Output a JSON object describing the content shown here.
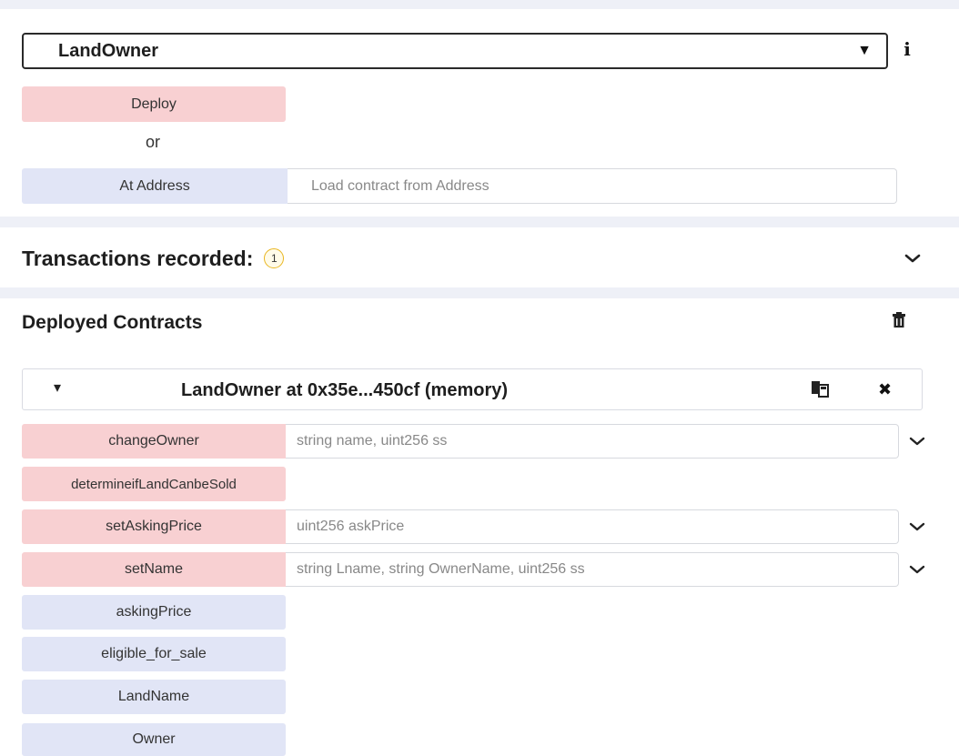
{
  "contract_select": {
    "selected": "LandOwner",
    "caret": "▼",
    "info_icon": "i"
  },
  "deploy": {
    "deploy_label": "Deploy",
    "or_label": "or",
    "at_address_label": "At Address",
    "address_placeholder": "Load contract from Address"
  },
  "transactions": {
    "label": "Transactions recorded:",
    "count": "1",
    "chevron": "⌄"
  },
  "deployed": {
    "title": "Deployed Contracts",
    "trash_icon": "trash-icon",
    "instance": {
      "toggle": "▾",
      "title": "LandOwner at 0x35e...450cf (memory)",
      "copy_icon": "copy-icon",
      "close": "✖"
    },
    "functions": [
      {
        "label": "changeOwner",
        "kind": "transact",
        "placeholder": "string name, uint256 ss",
        "chevron": "⌄"
      },
      {
        "label": "determineifLandCanbeSold",
        "kind": "transact",
        "placeholder": "",
        "chevron": ""
      },
      {
        "label": "setAskingPrice",
        "kind": "transact",
        "placeholder": "uint256 askPrice",
        "chevron": "⌄"
      },
      {
        "label": "setName",
        "kind": "transact",
        "placeholder": "string Lname, string OwnerName, uint256 ss",
        "chevron": "⌄"
      },
      {
        "label": "askingPrice",
        "kind": "call",
        "placeholder": "",
        "chevron": ""
      },
      {
        "label": "eligible_for_sale",
        "kind": "call",
        "placeholder": "",
        "chevron": ""
      },
      {
        "label": "LandName",
        "kind": "call",
        "placeholder": "",
        "chevron": ""
      },
      {
        "label": "Owner",
        "kind": "call",
        "placeholder": "",
        "chevron": ""
      }
    ]
  },
  "colors": {
    "transact_bg": "#f8d0d2",
    "call_bg": "#e1e5f6",
    "badge_border": "#e9b620"
  }
}
